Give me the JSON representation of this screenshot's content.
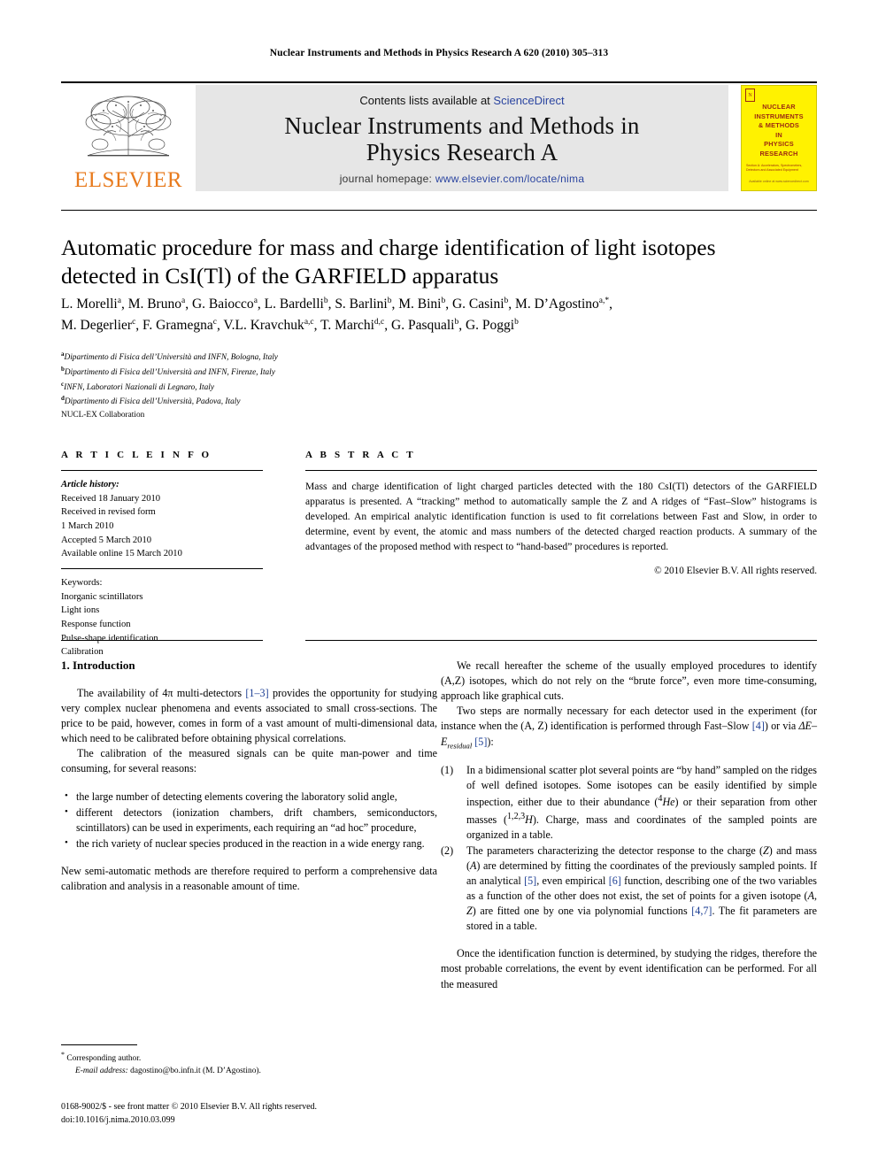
{
  "running_head": "Nuclear Instruments and Methods in Physics Research A 620 (2010) 305–313",
  "masthead": {
    "publisher_name": "ELSEVIER",
    "contents_prefix": "Contents lists available at ",
    "contents_link": "ScienceDirect",
    "journal_title_line1": "Nuclear Instruments and Methods in",
    "journal_title_line2": "Physics Research A",
    "homepage_prefix": "journal homepage: ",
    "homepage_url": "www.elsevier.com/locate/nima",
    "cover": {
      "title": "NUCLEAR\nINSTRUMENTS\n& METHODS\nIN\nPHYSICS\nRESEARCH",
      "subtitle": "Section A: Accelerators, Spectrometers,\nDetectors and Associated Equipment",
      "footer": "Available online at www.sciencedirect.com"
    }
  },
  "article": {
    "title": "Automatic procedure for mass and charge identification of light isotopes detected in CsI(Tl) of the GARFIELD apparatus",
    "authors_line1": "L. Morelli a, M. Bruno a, G. Baiocco a, L. Bardelli b, S. Barlini b, M. Bini b, G. Casini b, M. D’Agostino a,*,",
    "authors_line2": "M. Degerlier c, F. Gramegna c, V.L. Kravchuk a,c, T. Marchi d,c, G. Pasquali b, G. Poggi b",
    "affiliations": [
      {
        "mark": "a",
        "text": "Dipartimento di Fisica dell’Università and INFN, Bologna, Italy"
      },
      {
        "mark": "b",
        "text": "Dipartimento di Fisica dell’Università and INFN, Firenze, Italy"
      },
      {
        "mark": "c",
        "text": "INFN, Laboratori Nazionali di Legnaro, Italy"
      },
      {
        "mark": "d",
        "text": "Dipartimento di Fisica dell’Università, Padova, Italy"
      }
    ],
    "collaboration": "NUCL-EX Collaboration"
  },
  "info": {
    "heading": "A R T I C L E   I N F O",
    "history_label": "Article history:",
    "history": [
      "Received 18 January 2010",
      "Received in revised form",
      "1 March 2010",
      "Accepted 5 March 2010",
      "Available online 15 March 2010"
    ],
    "keywords_label": "Keywords:",
    "keywords": [
      "Inorganic scintillators",
      "Light ions",
      "Response function",
      "Pulse-shape identification",
      "Calibration"
    ]
  },
  "abstract": {
    "heading": "A B S T R A C T",
    "text": "Mass and charge identification of light charged particles detected with the 180 CsI(Tl) detectors of the GARFIELD apparatus is presented. A “tracking” method to automatically sample the Z and A ridges of “Fast–Slow” histograms is developed. An empirical analytic identification function is used to fit correlations between Fast and Slow, in order to determine, event by event, the atomic and mass numbers of the detected charged reaction products. A summary of the advantages of the proposed method with respect to “hand-based” procedures is reported.",
    "copyright": "© 2010 Elsevier B.V. All rights reserved."
  },
  "body": {
    "section_heading": "1.  Introduction",
    "left": {
      "p1_a": "The availability of 4π multi-detectors ",
      "p1_ref": "[1–3]",
      "p1_b": " provides the opportunity for studying very complex nuclear phenomena and events associated to small cross-sections. The price to be paid, however, comes in form of a vast amount of multi-dimensional data, which need to be calibrated before obtaining physical correlations.",
      "p2": "The calibration of the measured signals can be quite man-power and time consuming, for several reasons:",
      "bullets": [
        "the large number of detecting elements covering the laboratory solid angle,",
        "different detectors (ionization chambers, drift chambers, semiconductors, scintillators) can be used in experiments, each requiring an “ad hoc” procedure,",
        "the rich variety of nuclear species produced in the reaction in a wide energy rang."
      ],
      "p3": "New semi-automatic methods are therefore required to perform a comprehensive data calibration and analysis in a reasonable amount of time."
    },
    "right": {
      "p1": "We recall hereafter the scheme of the usually employed procedures to identify (A,Z) isotopes, which do not rely on the “brute force”, even more time-consuming, approach like graphical cuts.",
      "p2_a": "Two steps are normally necessary for each detector used in the experiment (for instance when the (A, Z) identification is performed through Fast–Slow ",
      "p2_ref1": "[4]",
      "p2_b": ") or via ΔE–E",
      "p2_sub": "residual",
      "p2_c": " ",
      "p2_ref2": "[5]",
      "p2_d": "):",
      "items": [
        {
          "num": "(1)",
          "text": "In a bidimensional scatter plot several points are “by hand” sampled on the ridges of well defined isotopes. Some isotopes can be easily identified by simple inspection, either due to their abundance (4He) or their separation from other masses (1,2,3H). Charge, mass and coordinates of the sampled points are organized in a table."
        },
        {
          "num": "(2)",
          "text": "The parameters characterizing the detector response to the charge (Z) and mass (A) are determined by fitting the coordinates of the previously sampled points. If an analytical [5], even empirical [6] function, describing one of the two variables as a function of the other does not exist, the set of points for a given isotope (A, Z) are fitted one by one via polynomial functions [4,7]. The fit parameters are stored in a table."
        }
      ],
      "p3": "Once the identification function is determined, by studying the ridges, therefore the most probable correlations, the event by event identification can be performed. For all the measured"
    }
  },
  "footnote": {
    "star": "*",
    "corresponding": "Corresponding author.",
    "email_label": "E-mail address:",
    "email": "dagostino@bo.infn.it (M. D’Agostino).",
    "issn_line1": "0168-9002/$ - see front matter © 2010 Elsevier B.V. All rights reserved.",
    "issn_line2": "doi:10.1016/j.nima.2010.03.099"
  },
  "colors": {
    "link": "#2b45a0",
    "reference": "#1d3f94",
    "elsevier_orange": "#E87B1E",
    "cover_yellow": "#FFF200",
    "cover_red": "#9c2a12",
    "banner_grey": "#e6e6e6"
  }
}
